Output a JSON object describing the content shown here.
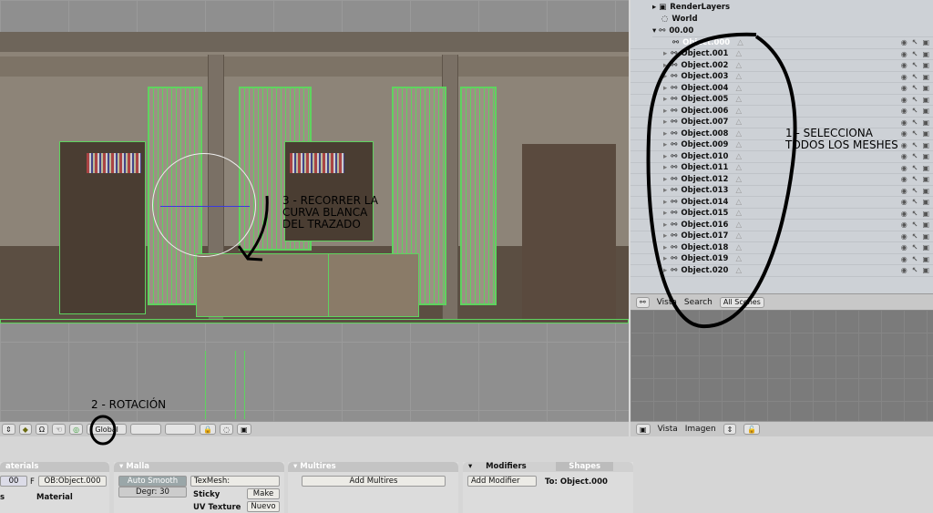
{
  "outliner": {
    "render_layers": "RenderLayers",
    "world": "World",
    "scene": "00.00",
    "objects": [
      "Object.000",
      "Object.001",
      "Object.002",
      "Object.003",
      "Object.004",
      "Object.005",
      "Object.006",
      "Object.007",
      "Object.008",
      "Object.009",
      "Object.010",
      "Object.011",
      "Object.012",
      "Object.013",
      "Object.014",
      "Object.015",
      "Object.016",
      "Object.017",
      "Object.018",
      "Object.019",
      "Object.020"
    ],
    "selected": "Object.000",
    "header": {
      "view": "Vista",
      "search": "Search",
      "scenes": "All Scenes"
    }
  },
  "viewport_header": {
    "orientation": "Global"
  },
  "image_header": {
    "view": "Vista",
    "image": "Imagen"
  },
  "panels": {
    "materials": {
      "title": "aterials",
      "index": "00",
      "f": "F",
      "ob": "OB:Object.000",
      "label_s": "s",
      "material": "Material"
    },
    "mesh": {
      "title": "Malla",
      "auto_smooth": "Auto Smooth",
      "degr": "Degr: 30",
      "texmesh": "TexMesh:",
      "sticky": "Sticky",
      "make": "Make",
      "uv_texture": "UV Texture",
      "new": "Nuevo"
    },
    "multires": {
      "title": "Multires",
      "add": "Add Multires"
    },
    "modifiers": {
      "tab_modifiers": "Modifiers",
      "tab_shapes": "Shapes",
      "add": "Add Modifier",
      "to": "To: Object.000"
    }
  },
  "annotations": {
    "step1": "1 - SELECCIONA\nTODOS LOS MESHES",
    "step2": "2 - ROTACIÓN",
    "step3": "3 - RECORRER LA\nCURVA BLANCA\nDEL TRAZADO",
    "ink_color": "#000000"
  },
  "colors": {
    "wireframe": "#5fd35f",
    "selected_text": "#ffffff"
  }
}
